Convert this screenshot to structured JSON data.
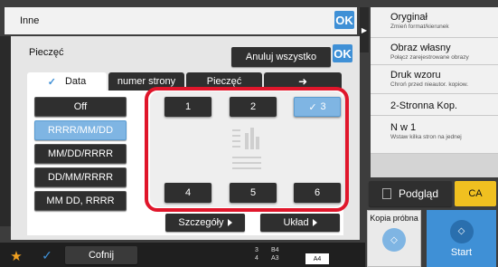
{
  "header": {
    "title": "Inne",
    "ok": "OK"
  },
  "dialog": {
    "title": "Pieczęć",
    "ok": "OK",
    "cancel_all": "Anuluj wszystko"
  },
  "tabs": [
    {
      "label": "Data"
    },
    {
      "label": "numer strony"
    },
    {
      "label": "Pieczęć"
    }
  ],
  "formats": [
    "Off",
    "RRRR/MM/DD",
    "MM/DD/RRRR",
    "DD/MM/RRRR",
    "MM DD, RRRR"
  ],
  "positions_top": [
    "1",
    "2",
    "3"
  ],
  "positions_bottom": [
    "4",
    "5",
    "6"
  ],
  "details_label": "Szczegóły",
  "layout_label": "Układ",
  "right_panel": [
    {
      "title": "Oryginał",
      "sub": "Zmień format/kierunek"
    },
    {
      "title": "Obraz własny",
      "sub": "Połącz zarejestrowane obrazy"
    },
    {
      "title": "Druk wzoru",
      "sub": "Chroń przed nieautor. kopiow."
    },
    {
      "title": "2-Stronna Kop.",
      "sub": ""
    },
    {
      "title": "N w 1",
      "sub": "Wstaw kilka stron na jednej"
    }
  ],
  "preview_label": "Podgląd",
  "ca_label": "CA",
  "proof_label": "Kopia próbna",
  "start_label": "Start",
  "back_label": "Cofnij",
  "tray": {
    "top": [
      "3",
      "B4"
    ],
    "bottom": [
      "4",
      "A3"
    ],
    "paper": "A4"
  },
  "colors": {
    "accent": "#3f90d6",
    "highlight": "#e0162b",
    "selected": "#7fb5e3",
    "ca": "#f0c020"
  }
}
